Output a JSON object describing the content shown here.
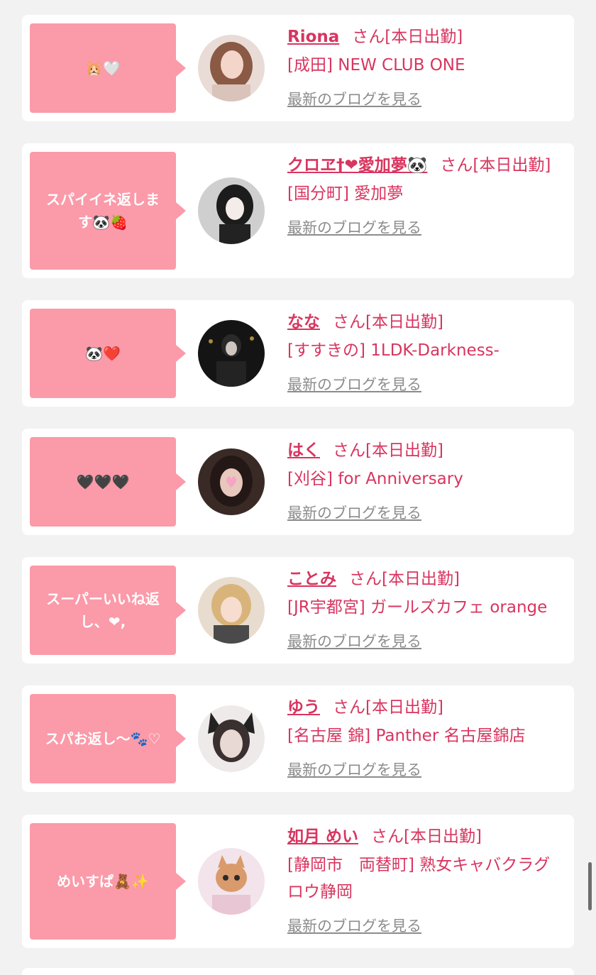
{
  "colors": {
    "accent": "#d8355f",
    "bubble": "#fb9aa9",
    "link_gray": "#8c8c8c",
    "background": "#f2f2f2"
  },
  "cards": [
    {
      "bubble": "🐹🤍",
      "name": "Riona",
      "honorific": "さん[本日出勤]",
      "shop": "[成田] NEW CLUB ONE",
      "blog": "最新のブログを見る",
      "avatar_icon": "avatar-photo"
    },
    {
      "bubble": "スパイイネ返しま す🐼🍓",
      "name": "クロヱ†❤愛加夢🐼",
      "honorific": "さん[本日出勤]",
      "shop": "[国分町] 愛加夢",
      "blog": "最新のブログを見る",
      "avatar_icon": "avatar-photo"
    },
    {
      "bubble": "🐼❤️",
      "name": "なな",
      "honorific": "さん[本日出勤]",
      "shop": "[すすきの] 1LDK-Darkness-",
      "blog": "最新のブログを見る",
      "avatar_icon": "avatar-photo"
    },
    {
      "bubble": "🖤🖤🖤",
      "name": "はく",
      "honorific": "さん[本日出勤]",
      "shop": "[刈谷] for Anniversary",
      "blog": "最新のブログを見る",
      "avatar_icon": "avatar-photo"
    },
    {
      "bubble": "スーパーいいね返 し、❤︎,",
      "name": "ことみ",
      "honorific": "さん[本日出勤]",
      "shop": "[JR宇都宮] ガールズカフェ orange",
      "blog": "最新のブログを見る",
      "avatar_icon": "avatar-photo"
    },
    {
      "bubble": "スパお返し〜🐾♡",
      "name": "ゆう",
      "honorific": "さん[本日出勤]",
      "shop": "[名古屋 錦] Panther 名古屋錦店",
      "blog": "最新のブログを見る",
      "avatar_icon": "avatar-photo"
    },
    {
      "bubble": "めいすぱ🧸✨",
      "name": "如月 めい",
      "honorific": "さん[本日出勤]",
      "shop": "[静岡市　両替町] 熟女キャバクラグロウ静岡",
      "blog": "最新のブログを見る",
      "avatar_icon": "avatar-photo"
    }
  ]
}
